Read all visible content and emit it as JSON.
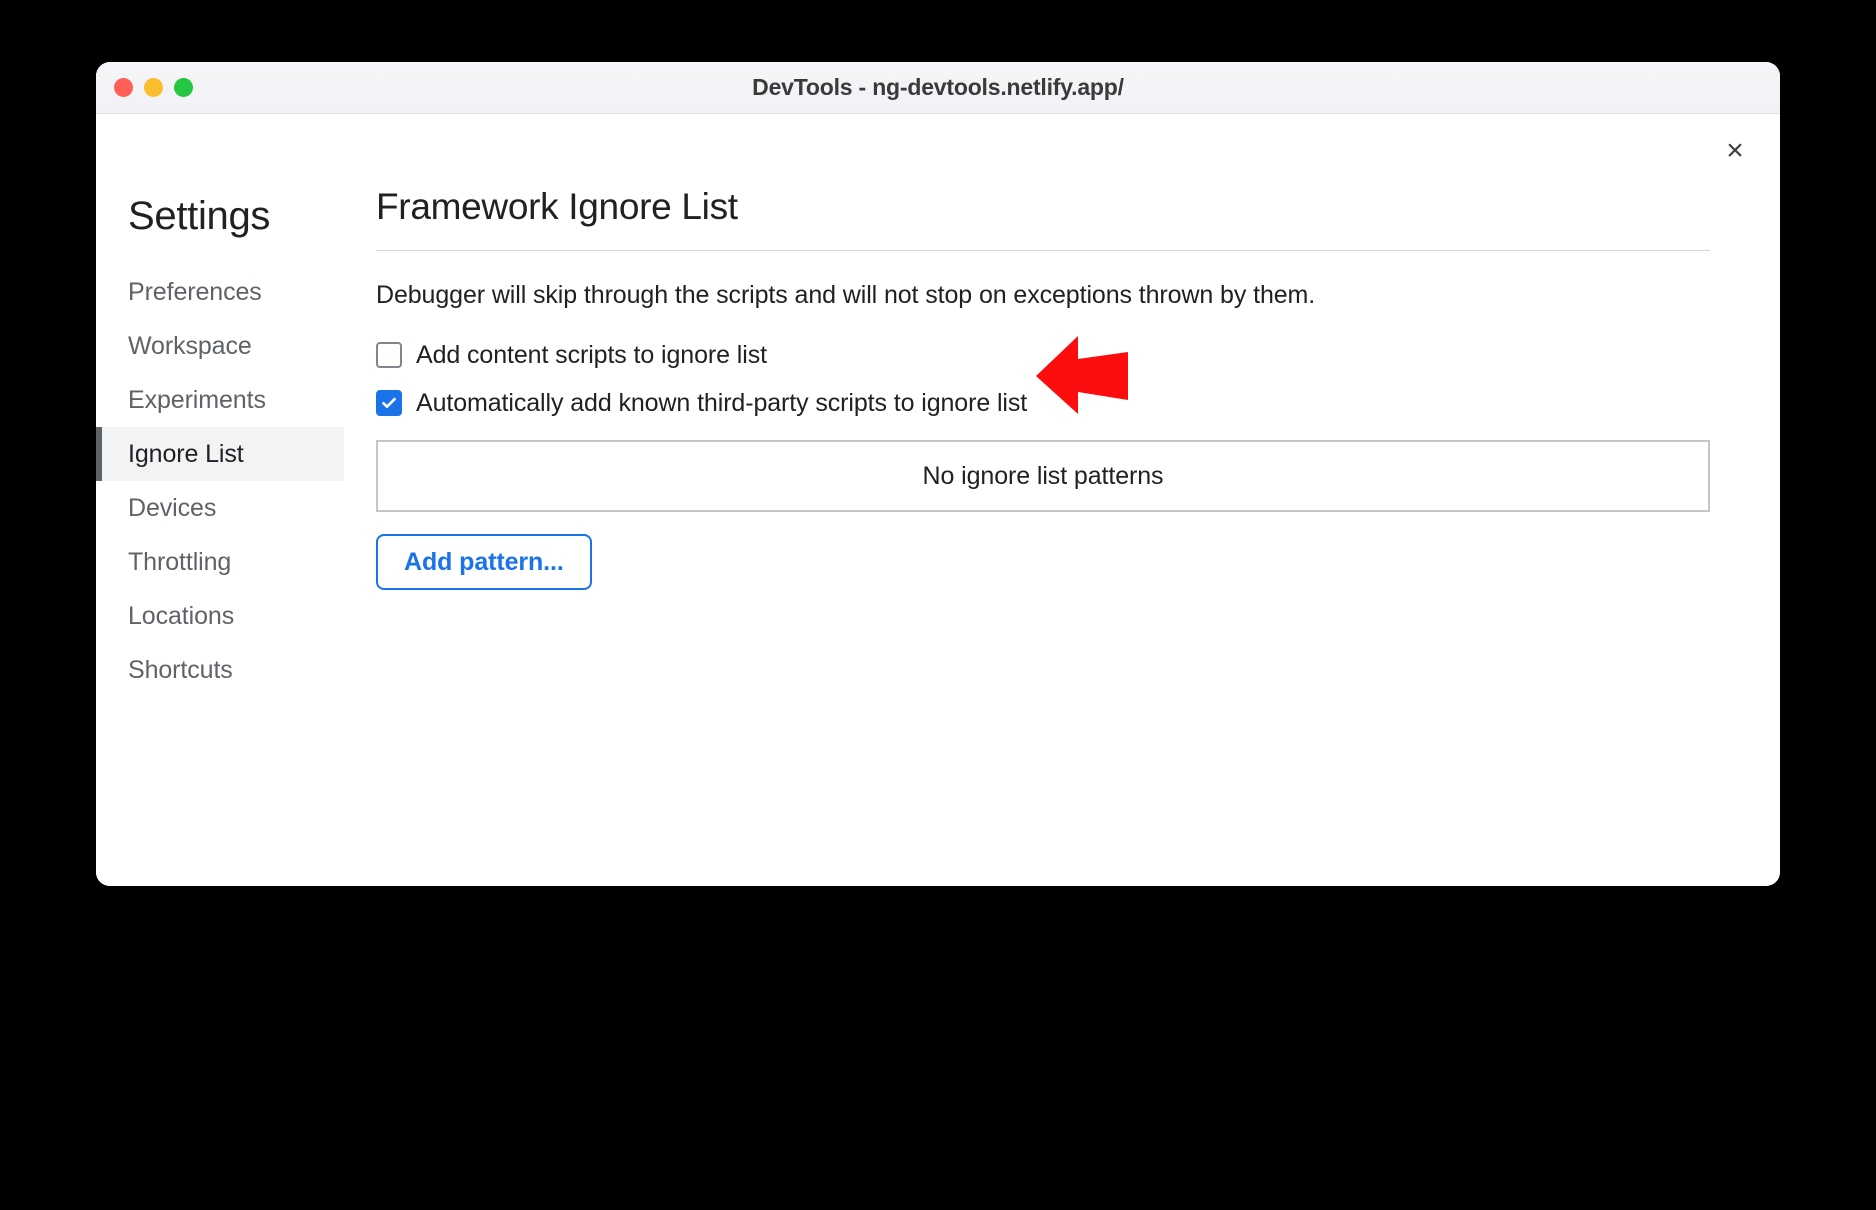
{
  "window": {
    "title": "DevTools - ng-devtools.netlify.app/",
    "traffic_lights": [
      "close",
      "minimize",
      "zoom"
    ],
    "close_icon": "×"
  },
  "sidebar": {
    "heading": "Settings",
    "items": [
      {
        "label": "Preferences",
        "selected": false
      },
      {
        "label": "Workspace",
        "selected": false
      },
      {
        "label": "Experiments",
        "selected": false
      },
      {
        "label": "Ignore List",
        "selected": true
      },
      {
        "label": "Devices",
        "selected": false
      },
      {
        "label": "Throttling",
        "selected": false
      },
      {
        "label": "Locations",
        "selected": false
      },
      {
        "label": "Shortcuts",
        "selected": false
      }
    ]
  },
  "content": {
    "title": "Framework Ignore List",
    "description": "Debugger will skip through the scripts and will not stop on exceptions thrown by them.",
    "checkboxes": [
      {
        "label": "Add content scripts to ignore list",
        "checked": false
      },
      {
        "label": "Automatically add known third-party scripts to ignore list",
        "checked": true
      }
    ],
    "patterns_empty_text": "No ignore list patterns",
    "add_pattern_label": "Add pattern..."
  },
  "annotation": {
    "type": "arrow",
    "direction": "left",
    "color": "#fc0d0d",
    "points_at": "Automatically add known third-party scripts to ignore list"
  },
  "colors": {
    "accent_blue": "#1a73e8",
    "annotation_red": "#fc0d0d",
    "selected_nav_bg": "#f1f3f4",
    "selected_nav_bar": "#5f6368",
    "text_primary": "#202124",
    "text_secondary": "#5f6368",
    "titlebar_bg": "#f3f2f6",
    "backdrop": "#000000"
  }
}
